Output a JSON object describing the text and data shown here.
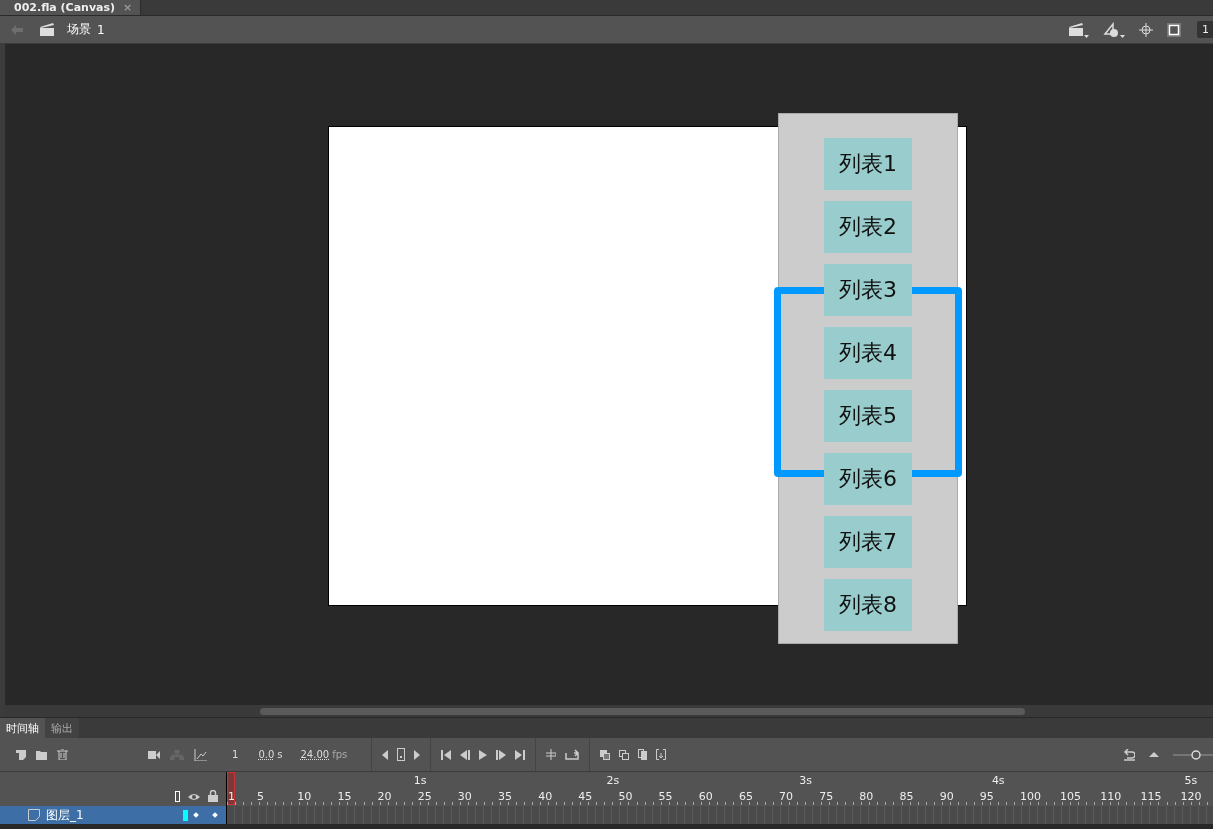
{
  "document_tabs": [
    {
      "label": "002.fla (Canvas)",
      "selected": true,
      "close": "×"
    }
  ],
  "edit_bar": {
    "scene_label": "场景",
    "scene_number": "1",
    "zoom_value": "1"
  },
  "stage": {
    "list_items": [
      "列表1",
      "列表2",
      "列表3",
      "列表4",
      "列表5",
      "列表6",
      "列表7",
      "列表8"
    ]
  },
  "panel_tabs": [
    {
      "label": "时间轴",
      "selected": true
    },
    {
      "label": "输出",
      "selected": false
    }
  ],
  "timeline": {
    "current_frame": "1",
    "time": "0.0",
    "time_unit": "s",
    "fps": "24.00",
    "fps_unit": "fps",
    "seconds": [
      "1s",
      "2s",
      "3s",
      "4s",
      "5s"
    ],
    "frames": [
      "1",
      "5",
      "10",
      "15",
      "20",
      "25",
      "30",
      "35",
      "40",
      "45",
      "50",
      "55",
      "60",
      "65",
      "70",
      "75",
      "80",
      "85",
      "90",
      "95",
      "100",
      "105",
      "110",
      "115",
      "120"
    ],
    "layers": [
      {
        "name": "图层_1",
        "selected": true,
        "color": "#00ffff"
      }
    ]
  }
}
